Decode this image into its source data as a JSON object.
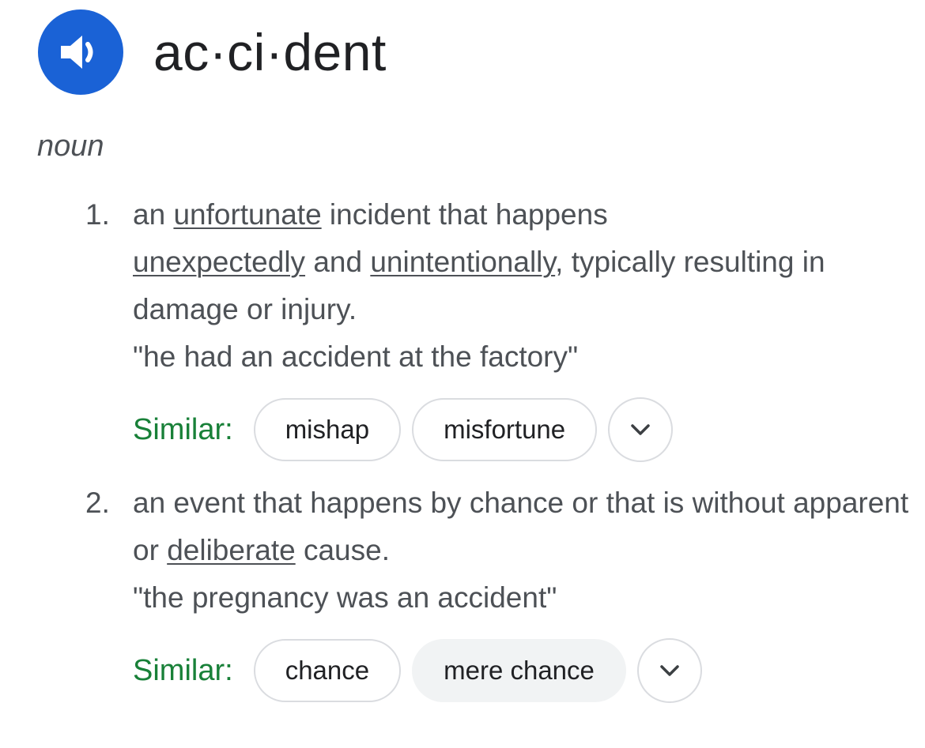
{
  "entry": {
    "headword": "ac·ci·dent",
    "part_of_speech": "noun",
    "speaker_icon": "volume-up-icon"
  },
  "colors": {
    "speaker_bg": "#1a62d6",
    "similar_label": "#188038",
    "body_text": "#4d5156"
  },
  "senses": [
    {
      "number": "1.",
      "definition": {
        "t1": "an ",
        "link1": "unfortunate",
        "t2": " incident that happens ",
        "link2": "unexpectedly",
        "t3": " and ",
        "link3": "unintentionally",
        "t4": ", typically resulting in damage or injury."
      },
      "example": "\"he had an accident at the factory\"",
      "similar_label": "Similar:",
      "similar": [
        "mishap",
        "misfortune"
      ],
      "expand_icon": "chevron-down-icon"
    },
    {
      "number": "2.",
      "definition": {
        "t1": "an event that happens by chance or that is without apparent or ",
        "link1": "deliberate",
        "t2": " cause."
      },
      "example": "\"the pregnancy was an accident\"",
      "similar_label": "Similar:",
      "similar": [
        "chance",
        "mere chance"
      ],
      "expand_icon": "chevron-down-icon"
    }
  ]
}
